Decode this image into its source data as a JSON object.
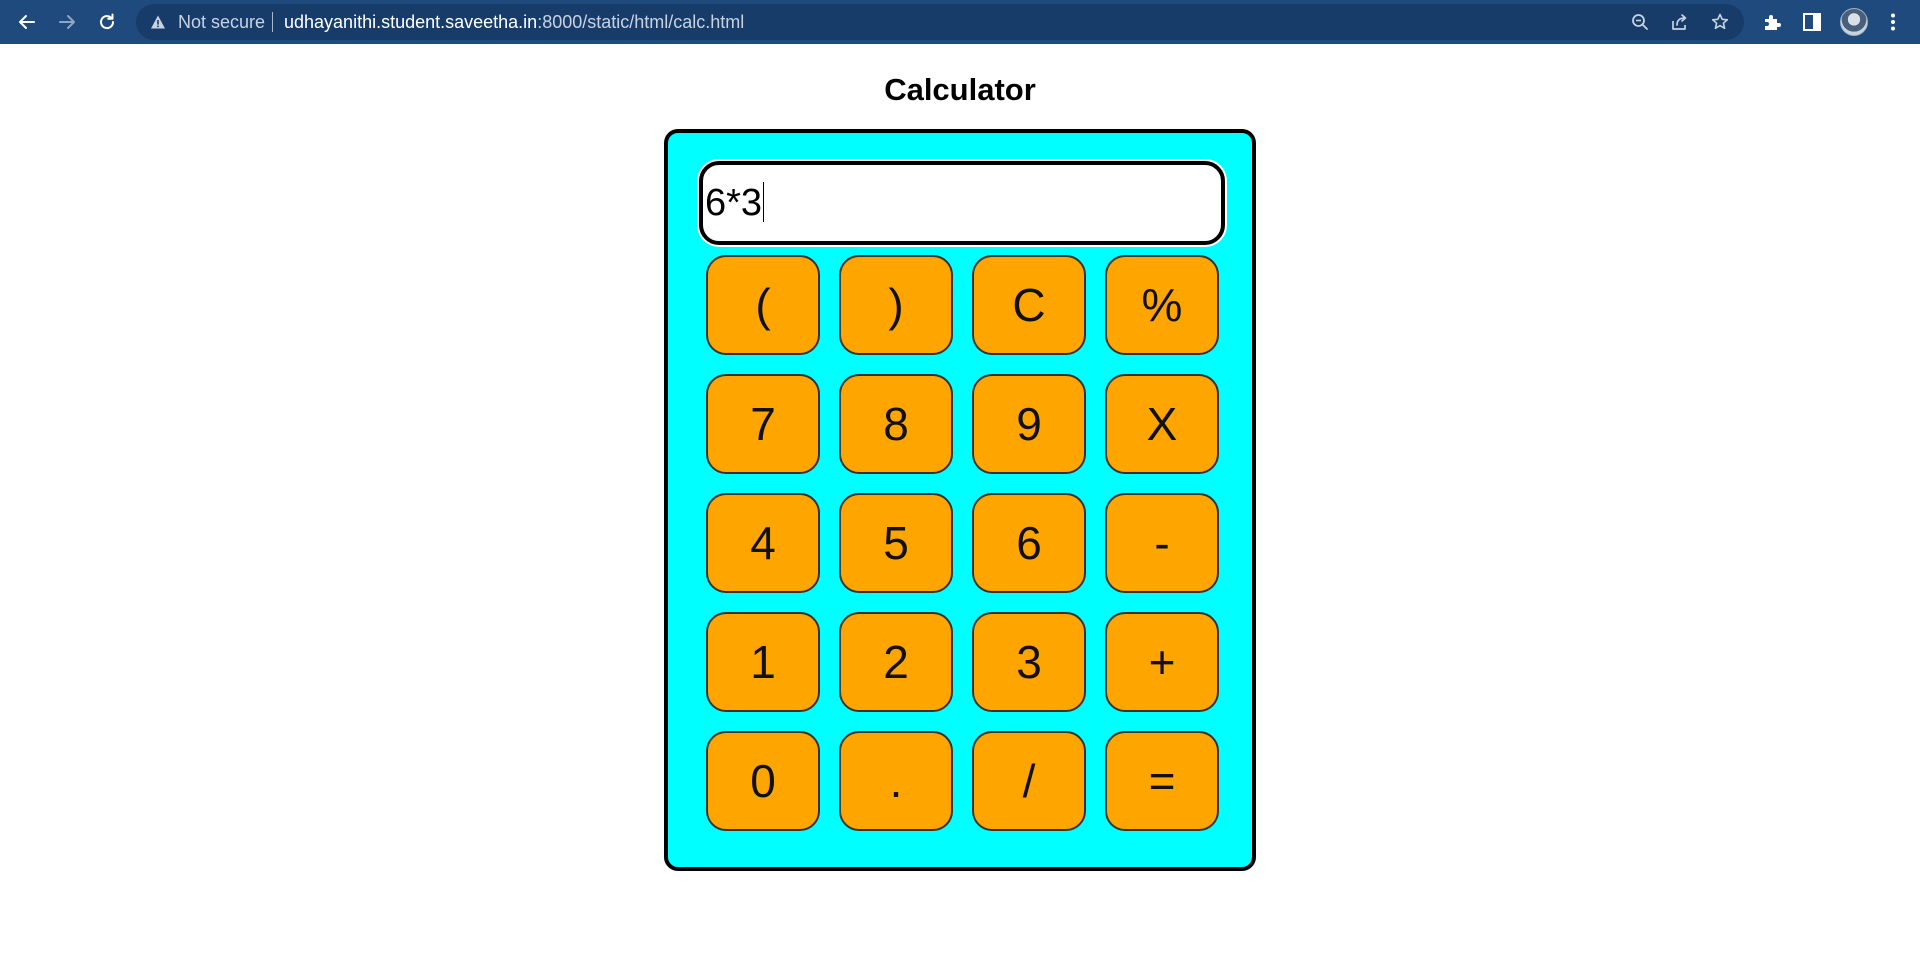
{
  "browser": {
    "security_label": "Not secure",
    "url_host": "udhayanithi.student.saveetha.in",
    "url_path": ":8000/static/html/calc.html"
  },
  "page": {
    "title": "Calculator"
  },
  "calculator": {
    "display_value": "6*3",
    "rows": [
      [
        "(",
        ")",
        "C",
        "%"
      ],
      [
        "7",
        "8",
        "9",
        "X"
      ],
      [
        "4",
        "5",
        "6",
        "-"
      ],
      [
        "1",
        "2",
        "3",
        "+"
      ],
      [
        "0",
        ".",
        "/",
        "="
      ]
    ]
  },
  "colors": {
    "chrome_bg": "#1f4a7d",
    "omnibox_bg": "#173c69",
    "calc_bg": "#00ffff",
    "button_bg": "#ffa500"
  }
}
